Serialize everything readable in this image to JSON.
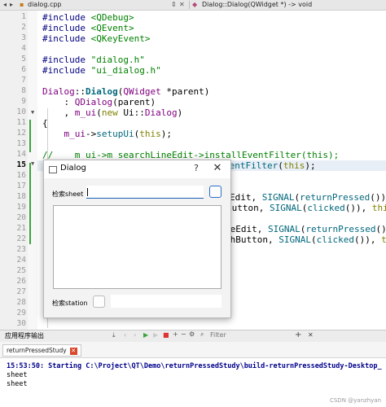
{
  "tabbar": {
    "file": "dialog.cpp",
    "symbol": "Dialog::Dialog(QWidget *) -> void"
  },
  "gutter": {
    "current_line": "15",
    "line_numbers": [
      "1",
      "2",
      "3",
      "4",
      "5",
      "6",
      "7",
      "8",
      "9",
      "10",
      "11",
      "12",
      "13",
      "14",
      "15",
      "16",
      "17",
      "18",
      "19",
      "20",
      "21",
      "22",
      "23",
      "24",
      "25",
      "26",
      "27",
      "28",
      "29",
      "30"
    ]
  },
  "code": {
    "l1a": "#include ",
    "l1b": "<QDebug>",
    "l2a": "#include ",
    "l2b": "<QEvent>",
    "l3a": "#include ",
    "l3b": "<QKeyEvent>",
    "l5a": "#include ",
    "l5b": "\"dialog.h\"",
    "l6a": "#include ",
    "l6b": "\"ui_dialog.h\"",
    "l8a": "Dialog",
    "l8b": "::",
    "l8c": "Dialog",
    "l8d": "(",
    "l8e": "QWidget",
    "l8f": " *parent)",
    "l9a": "    : ",
    "l9b": "QDialog",
    "l9c": "(parent)",
    "l10a": "    , ",
    "l10b": "m_ui",
    "l10c": "(",
    "l10d": "new",
    "l10e": " Ui::",
    "l10f": "Dialog",
    "l10g": ")",
    "l11": "{",
    "l12a": "    ",
    "l12b": "m_ui",
    "l12c": "->",
    "l12d": "setupUi",
    "l12e": "(",
    "l12f": "this",
    "l12g": ");",
    "l14": "//    m_ui->m_searchLineEdit->installEventFilter(this);",
    "l15a": "    ",
    "l15b": "installEventFilter",
    "l15c": "(",
    "l15d": "this",
    "l15e": ");",
    "l17a": "Edit, ",
    "l17b": "SIGNAL",
    "l17c": "(",
    "l17d": "returnPressed",
    "l17e": "()),",
    "l18a": "Button, ",
    "l18b": "SIGNAL",
    "l18c": "(",
    "l18d": "clicked",
    "l18e": "()), ",
    "l18f": "thi",
    "l20a": "neEdit, ",
    "l20b": "SIGNAL",
    "l20c": "(",
    "l20d": "returnPressed",
    "l20e": "()),",
    "l21a": "shButton, ",
    "l21b": "SIGNAL",
    "l21c": "(",
    "l21d": "clicked",
    "l21e": "()), ",
    "l21f": "t"
  },
  "dialog": {
    "title": "Dialog",
    "help_glyph": "?",
    "close_glyph": "✕",
    "search_label": "检索sheet",
    "search_value": "",
    "station_label": "检索station",
    "station_value": ""
  },
  "panel": {
    "title": "应用程序输出",
    "filter_placeholder": "Filter",
    "add_glyph": "+",
    "close_glyph": "✕",
    "tab_label": "returnPressedStudy",
    "tab_close": "✕",
    "output": [
      "15:53:50: Starting C:\\Project\\QT\\Demo\\returnPressedStudy\\build-returnPressedStudy-Desktop_",
      "sheet",
      "sheet"
    ]
  },
  "watermark": "CSDN @yanzhyan"
}
